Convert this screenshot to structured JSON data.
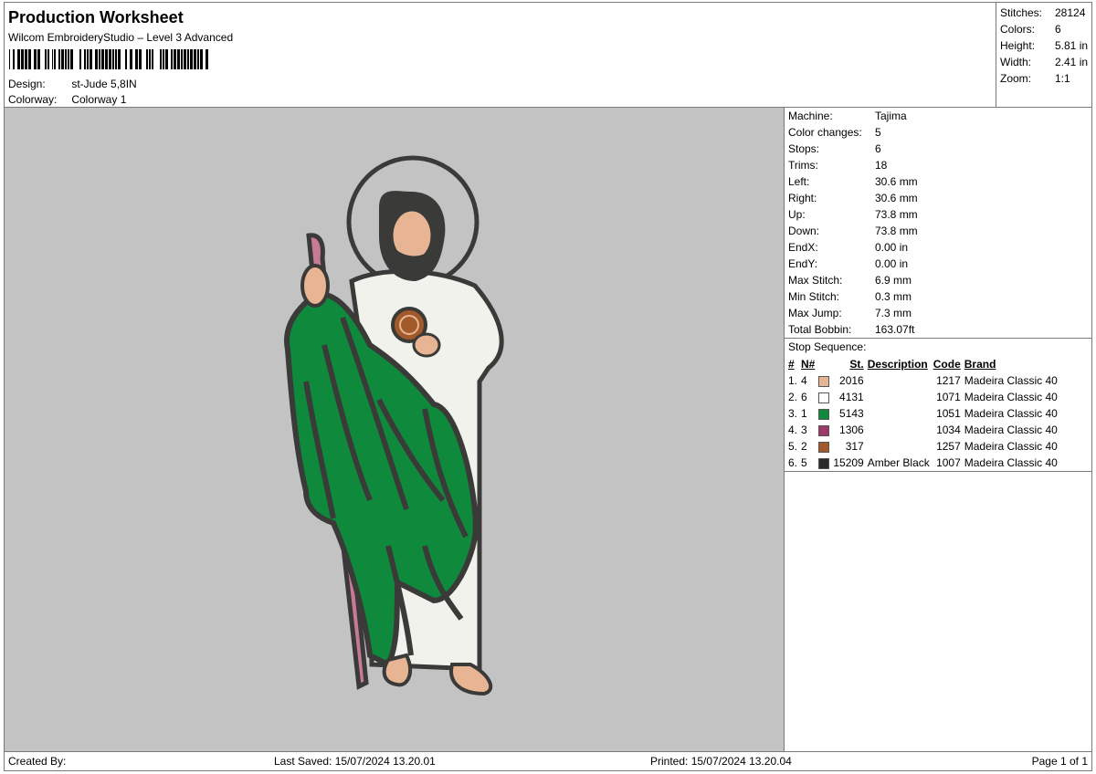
{
  "header": {
    "title": "Production Worksheet",
    "subtitle": "Wilcom EmbroideryStudio – Level 3 Advanced",
    "barcode_icon": "barcode-icon",
    "design_label": "Design:",
    "design_value": "st-Jude 5,8IN",
    "colorway_label": "Colorway:",
    "colorway_value": "Colorway 1"
  },
  "summary": [
    {
      "label": "Stitches:",
      "value": "28124"
    },
    {
      "label": "Colors:",
      "value": "6"
    },
    {
      "label": "Height:",
      "value": "5.81 in"
    },
    {
      "label": "Width:",
      "value": "2.41 in"
    },
    {
      "label": "Zoom:",
      "value": "1:1"
    }
  ],
  "machine": [
    {
      "label": "Machine:",
      "value": "Tajima"
    },
    {
      "label": "Color changes:",
      "value": "5"
    },
    {
      "label": "Stops:",
      "value": "6"
    },
    {
      "label": "Trims:",
      "value": "18"
    },
    {
      "label": "Left:",
      "value": "30.6 mm"
    },
    {
      "label": "Right:",
      "value": "30.6 mm"
    },
    {
      "label": "Up:",
      "value": "73.8 mm"
    },
    {
      "label": "Down:",
      "value": "73.8 mm"
    },
    {
      "label": "EndX:",
      "value": "0.00 in"
    },
    {
      "label": "EndY:",
      "value": "0.00 in"
    },
    {
      "label": "Max Stitch:",
      "value": "6.9 mm"
    },
    {
      "label": "Min Stitch:",
      "value": "0.3 mm"
    },
    {
      "label": "Max Jump:",
      "value": "7.3 mm"
    },
    {
      "label": "Total Bobbin:",
      "value": "163.07ft"
    }
  ],
  "stop_sequence": {
    "title": "Stop Sequence:",
    "headers": {
      "idx": "#",
      "n": "N#",
      "st": "St.",
      "desc": "Description",
      "code": "Code",
      "brand": "Brand"
    },
    "rows": [
      {
        "idx": "1.",
        "n": "4",
        "color": "#e8b594",
        "st": "2016",
        "desc": "",
        "code": "1217",
        "brand": "Madeira Classic 40"
      },
      {
        "idx": "2.",
        "n": "6",
        "color": "#ffffff",
        "st": "4131",
        "desc": "",
        "code": "1071",
        "brand": "Madeira Classic 40"
      },
      {
        "idx": "3.",
        "n": "1",
        "color": "#0f8a3c",
        "st": "5143",
        "desc": "",
        "code": "1051",
        "brand": "Madeira Classic 40"
      },
      {
        "idx": "4.",
        "n": "3",
        "color": "#a0386a",
        "st": "1306",
        "desc": "",
        "code": "1034",
        "brand": "Madeira Classic 40"
      },
      {
        "idx": "5.",
        "n": "2",
        "color": "#a25a2a",
        "st": "317",
        "desc": "",
        "code": "1257",
        "brand": "Madeira Classic 40"
      },
      {
        "idx": "6.",
        "n": "5",
        "color": "#2b2b2b",
        "st": "15209",
        "desc": "Amber Black",
        "code": "1007",
        "brand": "Madeira Classic 40"
      }
    ]
  },
  "footer": {
    "created_by": "Created By:",
    "last_saved": "Last Saved: 15/07/2024 13.20.01",
    "printed": "Printed: 15/07/2024 13.20.04",
    "page": "Page 1 of 1"
  },
  "colors": {
    "canvas_bg": "#c3c3c3",
    "robe_green": "#0f8a3c",
    "outline": "#3a3a38",
    "staff_pink": "#c77a95",
    "skin": "#e8b594",
    "tunic": "#f2f2ec"
  },
  "design_image": "embroidery-st-jude-figure"
}
